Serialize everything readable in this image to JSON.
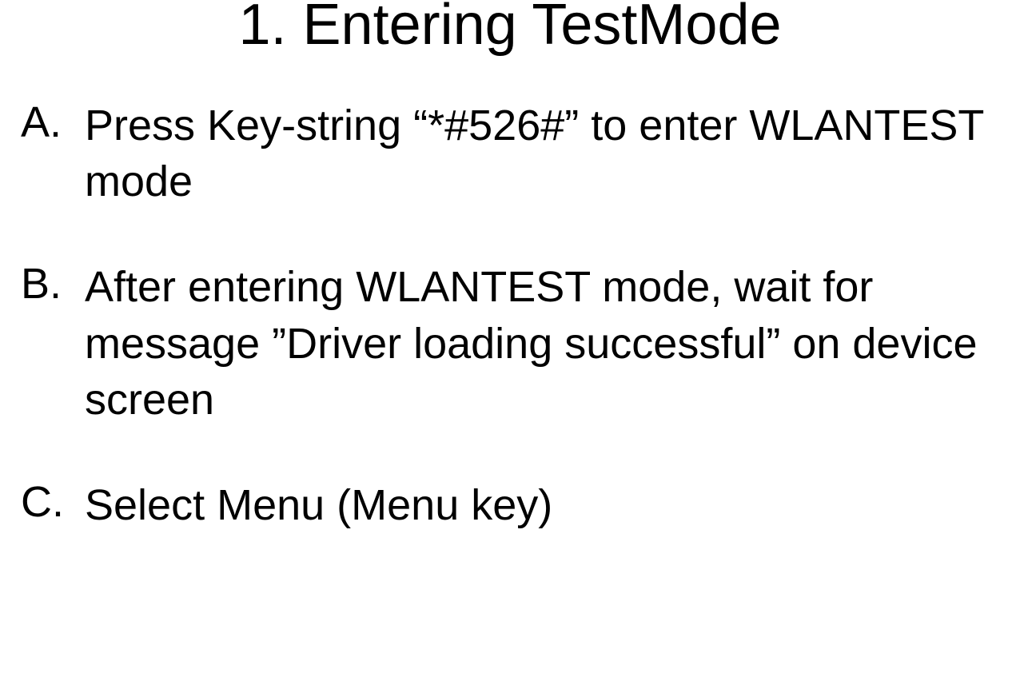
{
  "title": "1. Entering TestMode",
  "items": [
    {
      "marker": "A.",
      "text": "Press Key-string “*#526#” to enter WLANTEST mode"
    },
    {
      "marker": "B.",
      "text": "After entering WLANTEST mode, wait for message ”Driver loading successful” on device screen"
    },
    {
      "marker": "C.",
      "text": "Select Menu (Menu key)"
    }
  ]
}
